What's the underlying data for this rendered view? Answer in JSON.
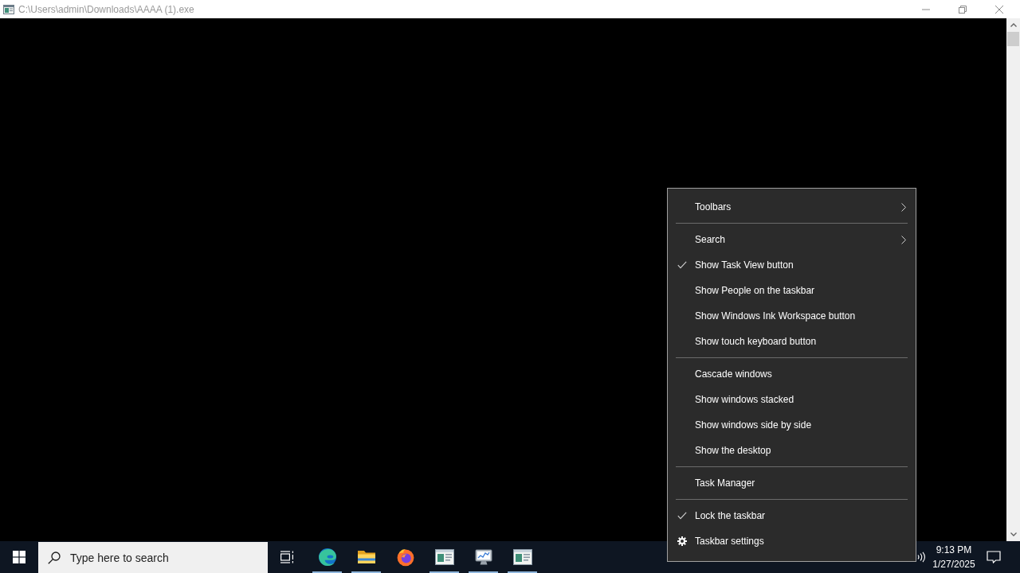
{
  "window": {
    "title": "C:\\Users\\admin\\Downloads\\AAAA (1).exe"
  },
  "context_menu": {
    "sections": [
      {
        "items": [
          {
            "label": "Toolbars",
            "kind": "submenu",
            "checked": false
          }
        ]
      },
      {
        "items": [
          {
            "label": "Search",
            "kind": "submenu",
            "checked": false
          },
          {
            "label": "Show Task View button",
            "kind": "command",
            "checked": true
          },
          {
            "label": "Show People on the taskbar",
            "kind": "command",
            "checked": false
          },
          {
            "label": "Show Windows Ink Workspace button",
            "kind": "command",
            "checked": false
          },
          {
            "label": "Show touch keyboard button",
            "kind": "command",
            "checked": false
          }
        ]
      },
      {
        "items": [
          {
            "label": "Cascade windows",
            "kind": "command",
            "checked": false
          },
          {
            "label": "Show windows stacked",
            "kind": "command",
            "checked": false
          },
          {
            "label": "Show windows side by side",
            "kind": "command",
            "checked": false
          },
          {
            "label": "Show the desktop",
            "kind": "command",
            "checked": false
          }
        ]
      },
      {
        "items": [
          {
            "label": "Task Manager",
            "kind": "command",
            "checked": false
          }
        ]
      },
      {
        "items": [
          {
            "label": "Lock the taskbar",
            "kind": "command",
            "checked": true
          },
          {
            "label": "Taskbar settings",
            "kind": "settings",
            "checked": false
          }
        ]
      }
    ]
  },
  "taskbar": {
    "search": {
      "placeholder": "Type here to search"
    },
    "buttons": [
      {
        "kind": "task-view",
        "running": false
      },
      {
        "kind": "wave-browser",
        "running": true
      },
      {
        "kind": "folder",
        "running": true
      },
      {
        "kind": "flame-browser",
        "running": false
      },
      {
        "kind": "panel-window",
        "running": true
      },
      {
        "kind": "monitor-chart",
        "running": true
      },
      {
        "kind": "panel-window",
        "running": true
      }
    ],
    "clock": {
      "time": "9:13 PM",
      "date": "1/27/2025"
    }
  }
}
